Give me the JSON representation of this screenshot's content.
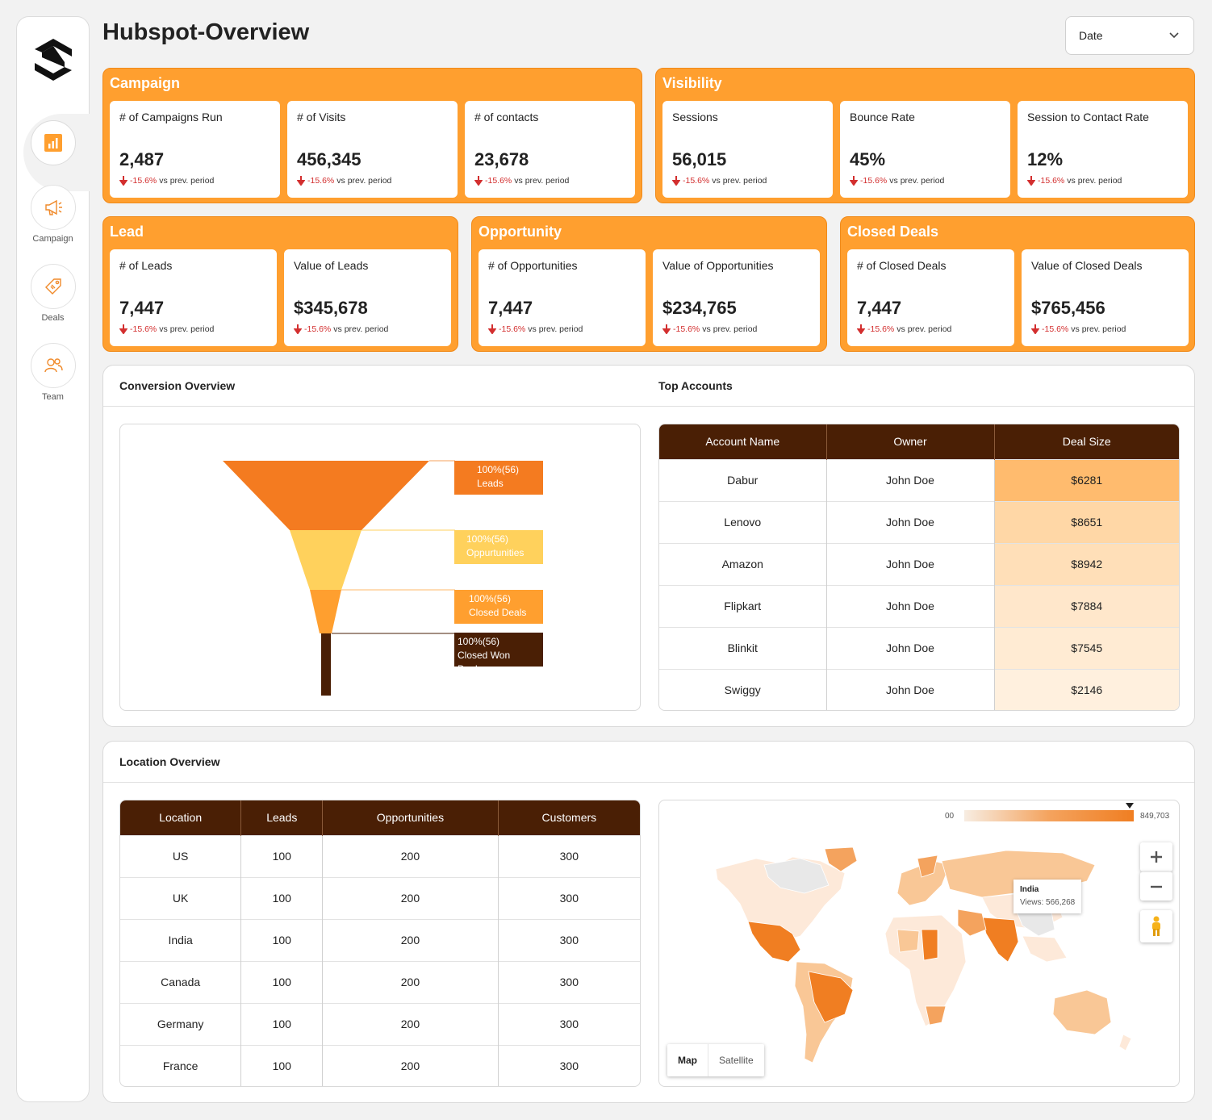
{
  "page": {
    "title": "Hubspot-Overview",
    "date_select": "Date"
  },
  "sidebar": {
    "items": [
      {
        "label": "",
        "icon": "bar-chart-icon"
      },
      {
        "label": "Campaign",
        "icon": "megaphone-icon"
      },
      {
        "label": "Deals",
        "icon": "tag-icon"
      },
      {
        "label": "Team",
        "icon": "team-icon"
      }
    ]
  },
  "colors": {
    "accent": "#ff9f2f",
    "dark": "#4a1f05",
    "negative": "#d32f2f"
  },
  "delta": {
    "value": "-15.6%",
    "suffix": "vs prev. period"
  },
  "groups": {
    "campaign": {
      "title": "Campaign",
      "kpis": [
        {
          "label": "# of Campaigns Run",
          "value": "2,487"
        },
        {
          "label": "# of Visits",
          "value": "456,345"
        },
        {
          "label": "# of contacts",
          "value": "23,678"
        }
      ]
    },
    "visibility": {
      "title": "Visibility",
      "kpis": [
        {
          "label": "Sessions",
          "value": "56,015"
        },
        {
          "label": "Bounce Rate",
          "value": "45%"
        },
        {
          "label": "Session to Contact Rate",
          "value": "12%"
        }
      ]
    },
    "lead": {
      "title": "Lead",
      "kpis": [
        {
          "label": "# of Leads",
          "value": "7,447"
        },
        {
          "label": "Value of Leads",
          "value": "$345,678"
        }
      ]
    },
    "opportunity": {
      "title": "Opportunity",
      "kpis": [
        {
          "label": "# of Opportunities",
          "value": "7,447"
        },
        {
          "label": "Value of Opportunities",
          "value": "$234,765"
        }
      ]
    },
    "closed": {
      "title": "Closed Deals",
      "kpis": [
        {
          "label": "# of Closed Deals",
          "value": "7,447"
        },
        {
          "label": "Value of Closed Deals",
          "value": "$765,456"
        }
      ]
    }
  },
  "conversion": {
    "title": "Conversion Overview",
    "stages": [
      {
        "pct": "100%(56)",
        "name": "Leads"
      },
      {
        "pct": "100%(56)",
        "name": "Oppurtunities"
      },
      {
        "pct": "100%(56)",
        "name": "Closed Deals"
      },
      {
        "pct": "100%(56)",
        "name": "Closed Won Deals"
      }
    ]
  },
  "top_accounts": {
    "title": "Top Accounts",
    "columns": [
      "Account Name",
      "Owner",
      "Deal Size"
    ],
    "rows": [
      [
        "Dabur",
        "John Doe",
        "$6281"
      ],
      [
        "Lenovo",
        "John Doe",
        "$8651"
      ],
      [
        "Amazon",
        "John Doe",
        "$8942"
      ],
      [
        "Flipkart",
        "John Doe",
        "$7884"
      ],
      [
        "Blinkit",
        "John Doe",
        "$7545"
      ],
      [
        "Swiggy",
        "John Doe",
        "$2146"
      ]
    ],
    "deal_colors": [
      "#ffbb6e",
      "#ffd7a6",
      "#ffdfb8",
      "#ffe7cb",
      "#ffebd3",
      "#fff0de"
    ]
  },
  "location": {
    "title": "Location Overview",
    "columns": [
      "Location",
      "Leads",
      "Opportunities",
      "Customers"
    ],
    "rows": [
      [
        "US",
        "100",
        "200",
        "300"
      ],
      [
        "UK",
        "100",
        "200",
        "300"
      ],
      [
        "India",
        "100",
        "200",
        "300"
      ],
      [
        "Canada",
        "100",
        "200",
        "300"
      ],
      [
        "Germany",
        "100",
        "200",
        "300"
      ],
      [
        "France",
        "100",
        "200",
        "300"
      ]
    ]
  },
  "map": {
    "legend_min": "00",
    "legend_max": "849,703",
    "tooltip_country": "India",
    "tooltip_views": "Views: 566,268",
    "type_map": "Map",
    "type_satellite": "Satellite"
  }
}
